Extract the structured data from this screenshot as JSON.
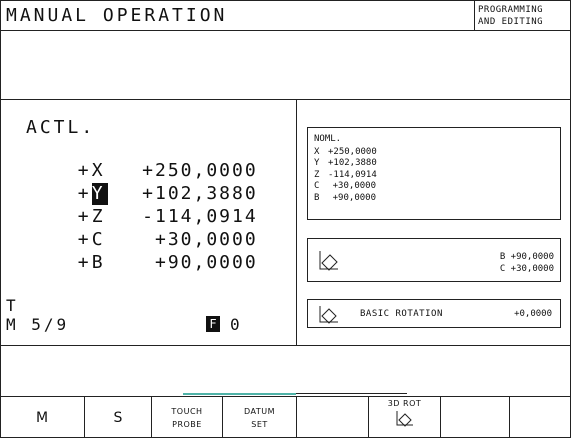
{
  "header": {
    "mode_title": "MANUAL OPERATION",
    "secondary_mode": [
      "PROGRAMMING",
      "AND EDITING"
    ]
  },
  "actual": {
    "label": "ACTL.",
    "rows": [
      {
        "mark": "+",
        "axis": "X",
        "value": "+250,0000",
        "highlighted": false
      },
      {
        "mark": "+",
        "axis": "Y",
        "value": "+102,3880",
        "highlighted": true
      },
      {
        "mark": "+",
        "axis": "Z",
        "value": "-114,0914",
        "highlighted": false
      },
      {
        "mark": "+",
        "axis": "C",
        "value": "+30,0000",
        "highlighted": false
      },
      {
        "mark": "+",
        "axis": "B",
        "value": "+90,0000",
        "highlighted": false
      }
    ]
  },
  "status": {
    "tool_label": "T",
    "m_function": "M 5/9",
    "feed_icon": "F",
    "feed_value": "0"
  },
  "nominal": {
    "title": "NOML.",
    "rows": [
      {
        "axis": "X",
        "value": "+250,0000"
      },
      {
        "axis": "Y",
        "value": "+102,3880"
      },
      {
        "axis": "Z",
        "value": "-114,0914"
      },
      {
        "axis": "C",
        "value": "+30,0000"
      },
      {
        "axis": "B",
        "value": "+90,0000"
      }
    ]
  },
  "tilt": {
    "icon": "tilted-plane-icon",
    "line1": "B +90,0000",
    "line2": "C +30,0000"
  },
  "basic_rotation": {
    "icon": "rotation-plane-icon",
    "label": "BASIC ROTATION",
    "value": "+0,0000"
  },
  "softkeys": {
    "m": "M",
    "s": "S",
    "touch_probe": [
      "TOUCH",
      "PROBE"
    ],
    "datum_set": [
      "DATUM",
      "SET"
    ],
    "rot_3d": "3D ROT"
  },
  "colors": {
    "accent": "#4fb3a8"
  }
}
